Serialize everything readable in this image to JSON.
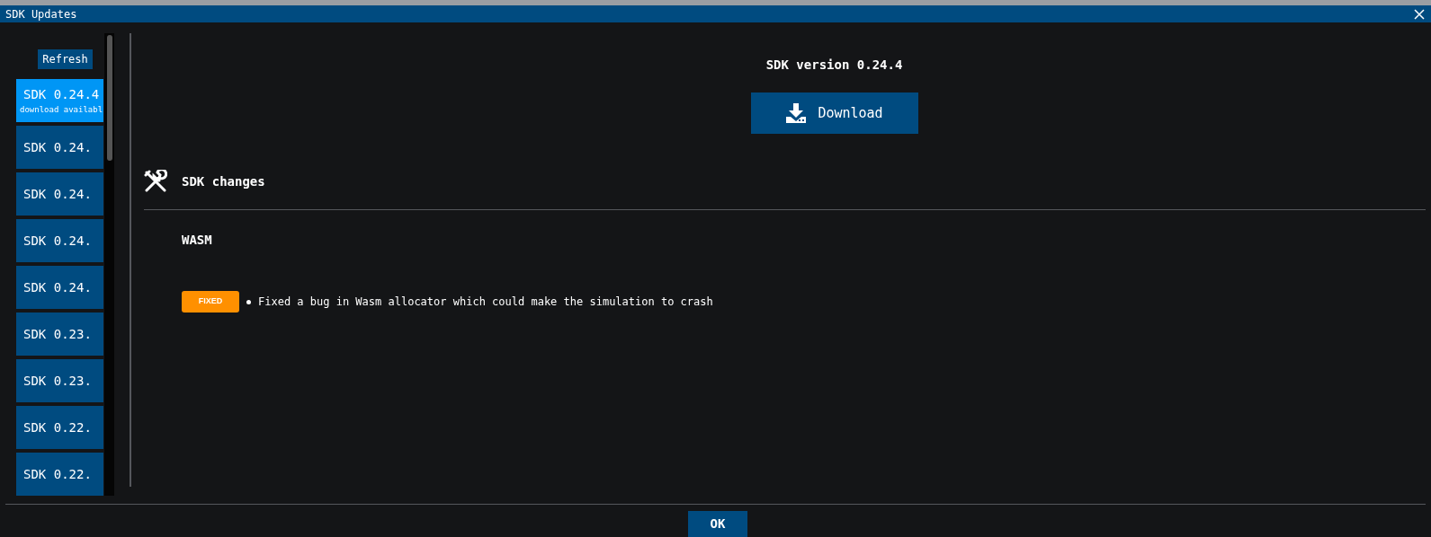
{
  "window": {
    "title": "SDK Updates"
  },
  "sidebar": {
    "refresh_button": "Refresh",
    "items": [
      {
        "label": "SDK 0.24.4",
        "sublabel": "download availabl",
        "selected": true
      },
      {
        "label": "SDK 0.24.",
        "selected": false
      },
      {
        "label": "SDK 0.24.",
        "selected": false
      },
      {
        "label": "SDK 0.24.",
        "selected": false
      },
      {
        "label": "SDK 0.24.",
        "selected": false
      },
      {
        "label": "SDK 0.23.",
        "selected": false
      },
      {
        "label": "SDK 0.23.",
        "selected": false
      },
      {
        "label": "SDK 0.22.",
        "selected": false
      },
      {
        "label": "SDK 0.22.",
        "selected": false
      }
    ]
  },
  "detail": {
    "title": "SDK version 0.24.4",
    "download_button": "Download",
    "section_title": "SDK changes",
    "groups": [
      {
        "name": "WASM",
        "changes": [
          {
            "kind": "fixed",
            "badge": "FIXED",
            "text": "Fixed a bug in Wasm allocator which could make the simulation to crash"
          }
        ]
      }
    ]
  },
  "footer": {
    "ok_button": "OK"
  }
}
